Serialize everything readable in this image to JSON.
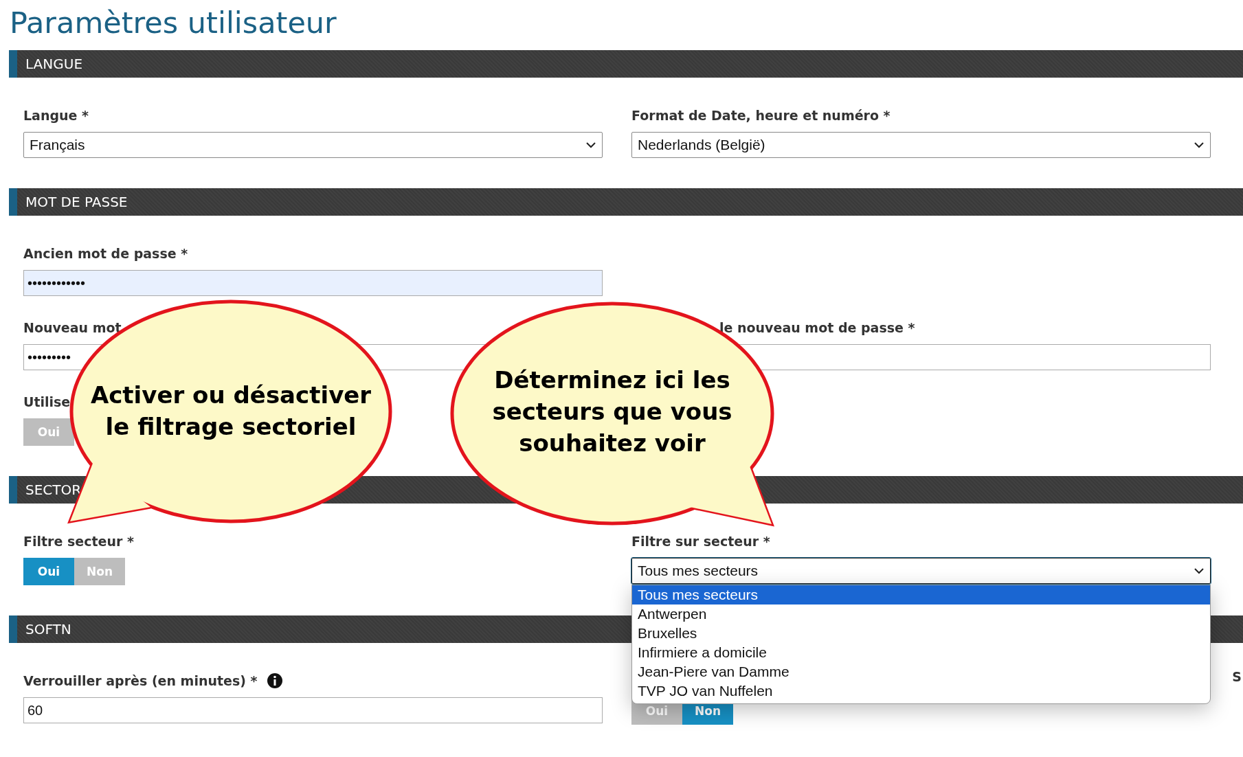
{
  "title": "Paramètres utilisateur",
  "sections": [
    {
      "heading": "LANGUE",
      "rows": [
        [
          {
            "kind": "select",
            "label": "Langue *",
            "value": "Français",
            "focused": false
          },
          {
            "kind": "select",
            "label": "Format de Date, heure et numéro *",
            "value": "Nederlands (België)",
            "focused": false
          }
        ]
      ]
    },
    {
      "heading": "MOT DE PASSE",
      "rows": [
        [
          {
            "kind": "password",
            "label": "Ancien mot de passe *",
            "value": "••••••••••••",
            "autofilled": true
          }
        ],
        [
          {
            "kind": "password",
            "label": "Nouveau mot",
            "value": "•••••••••",
            "autofilled": false
          },
          {
            "kind": "password",
            "label": "le nouveau mot de passe *",
            "autofilled": false
          }
        ],
        [
          {
            "kind": "toggle",
            "label": "Utilise",
            "options": [
              {
                "label": "Oui",
                "selected": false
              }
            ]
          }
        ]
      ]
    },
    {
      "heading": "SECTOR",
      "rows": [
        [
          {
            "kind": "toggle",
            "label": "Filtre secteur *",
            "options": [
              {
                "label": "Oui",
                "selected": true
              },
              {
                "label": "Non",
                "selected": false
              }
            ]
          },
          {
            "kind": "select",
            "label": "Filtre sur secteur *",
            "value": "Tous mes secteurs",
            "focused": true,
            "expanded": true,
            "options": [
              {
                "label": "Tous mes secteurs",
                "selected": true
              },
              {
                "label": "Antwerpen",
                "selected": false
              },
              {
                "label": "Bruxelles",
                "selected": false
              },
              {
                "label": "Infirmiere a domicile",
                "selected": false
              },
              {
                "label": "Jean-Piere van Damme",
                "selected": false
              },
              {
                "label": "TVP JO van Nuffelen",
                "selected": false
              }
            ]
          }
        ]
      ]
    },
    {
      "heading": "SOFTN",
      "edge_label": "S",
      "rows": [
        [
          {
            "kind": "text",
            "label": "Verrouiller après (en minutes) *",
            "info": true,
            "value": "60"
          },
          {
            "kind": "toggle",
            "options": [
              {
                "label": "Oui",
                "selected": false
              },
              {
                "label": "Non",
                "selected": true
              }
            ]
          }
        ]
      ]
    }
  ],
  "callouts": [
    {
      "lines": [
        "Activer ou désactiver",
        "le filtrage sectoriel"
      ]
    },
    {
      "lines": [
        "Déterminez ici les",
        "secteurs que vous",
        "souhaitez voir"
      ]
    }
  ]
}
